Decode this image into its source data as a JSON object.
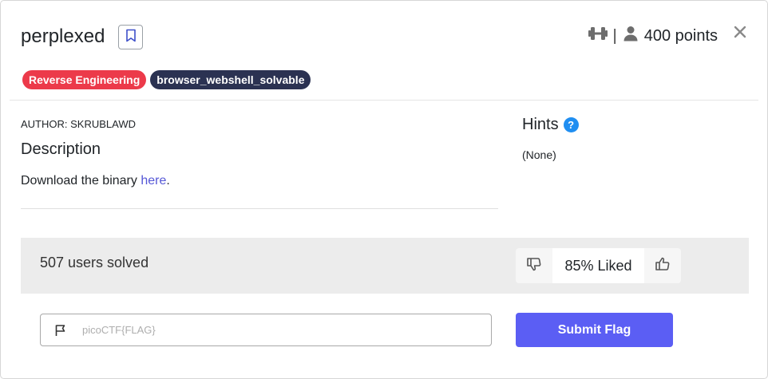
{
  "challenge": {
    "title": "perplexed",
    "points_label": "400 points",
    "separator": "|"
  },
  "tags": [
    {
      "label": "Reverse Engineering",
      "color": "#ec3a4a"
    },
    {
      "label": "browser_webshell_solvable",
      "color": "#2b3252"
    }
  ],
  "author": "AUTHOR: SKRUBLAWD",
  "description": {
    "heading": "Description",
    "text_before": "Download the binary ",
    "link_text": "here",
    "text_after": "."
  },
  "hints": {
    "heading": "Hints",
    "help_glyph": "?",
    "value": "(None)"
  },
  "stats": {
    "solved_label": "507 users solved",
    "liked_label": "85% Liked"
  },
  "flag": {
    "placeholder": "picoCTF{FLAG}",
    "value": "",
    "submit_label": "Submit Flag"
  },
  "icons": {
    "difficulty": "dumbbell-icon",
    "user": "user-icon",
    "bookmark": "bookmark-icon",
    "close": "close-icon",
    "thumbs_down": "thumbs-down-icon",
    "thumbs_up": "thumbs-up-icon",
    "flag": "flag-icon"
  },
  "colors": {
    "accent": "#5b5ef4",
    "link": "#5557d6",
    "help": "#1f8ef1"
  }
}
